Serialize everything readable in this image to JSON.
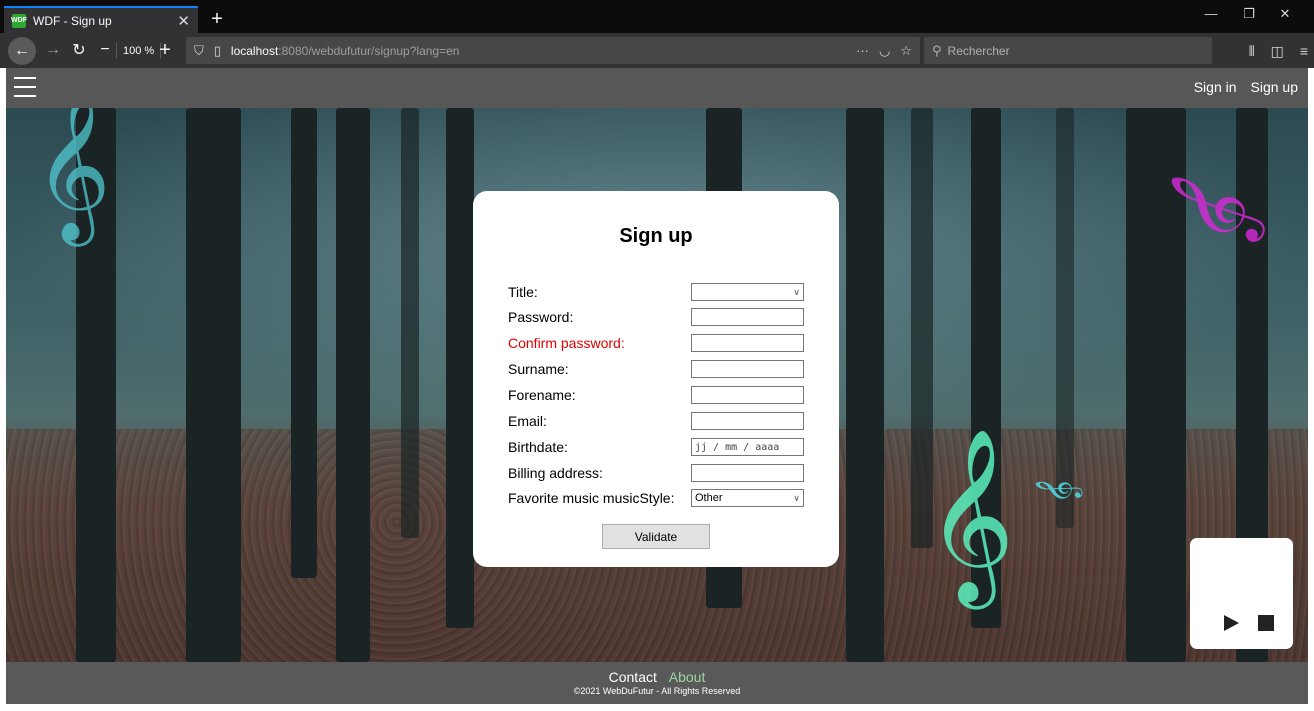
{
  "browser": {
    "tab_title": "WDF - Sign up",
    "favicon_text": "WDF",
    "zoom": "100 %",
    "url_host": "localhost",
    "url_rest": ":8080/webdufutur/signup?lang=en",
    "search_placeholder": "Rechercher"
  },
  "header": {
    "sign_in": "Sign in",
    "sign_up": "Sign up"
  },
  "form": {
    "title": "Sign up",
    "fields": [
      {
        "label": "Title:",
        "type": "select",
        "value": ""
      },
      {
        "label": "Password:",
        "type": "password",
        "value": ""
      },
      {
        "label": "Confirm password:",
        "type": "password",
        "value": "",
        "error": true
      },
      {
        "label": "Surname:",
        "type": "text",
        "value": ""
      },
      {
        "label": "Forename:",
        "type": "text",
        "value": ""
      },
      {
        "label": "Email:",
        "type": "text",
        "value": ""
      },
      {
        "label": "Birthdate:",
        "type": "date",
        "value": "jj / mm / aaaa"
      },
      {
        "label": "Billing address:",
        "type": "text",
        "value": ""
      },
      {
        "label": "Favorite music musicStyle:",
        "type": "select",
        "value": "Other"
      }
    ],
    "submit": "Validate"
  },
  "footer": {
    "contact": "Contact",
    "about": "About",
    "copyright": "©2021 WebDuFutur - All Rights Reserved"
  },
  "colors": {
    "error": "#e00000",
    "header_bg": "#575757",
    "footer_bg": "#595959",
    "accent_tab": "#0a84ff"
  },
  "icons": {
    "back": "back-arrow-icon",
    "forward": "forward-arrow-icon",
    "reload": "reload-icon",
    "shield": "shield-icon",
    "page": "page-icon",
    "more": "more-dots-icon",
    "pocket": "pocket-icon",
    "bookmark": "star-icon",
    "search": "search-icon",
    "menu": "hamburger-icon",
    "play": "play-icon",
    "stop": "stop-icon"
  }
}
